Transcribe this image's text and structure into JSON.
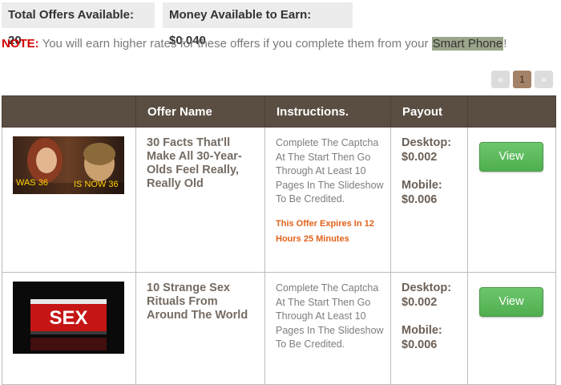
{
  "header": {
    "total_offers": "Total Offers Available: 20",
    "money_available": "Money Available to Earn: $0.040"
  },
  "note": {
    "label": "NOTE:",
    "text": " You will earn higher rates for these offers if you complete them from your ",
    "highlight": "Smart Phone",
    "end": "!"
  },
  "pagination": {
    "prev": "«",
    "current": "1",
    "next": "»"
  },
  "table": {
    "columns": [
      "",
      "Offer Name",
      "Instructions.",
      "Payout",
      ""
    ],
    "rows": [
      {
        "offer_name": "30 Facts That'll Make All 30-Year-Olds Feel Really, Really Old",
        "thumb_caption_left": "WAS 36",
        "thumb_caption_right": "IS NOW 36",
        "instructions": "Complete The Captcha At The Start Then Go Through At Least 10 Pages In The Slideshow To Be Credited.",
        "expires": "This Offer Expires In 12 Hours 25 Minutes",
        "desktop": "Desktop: $0.002",
        "mobile": "Mobile: $0.006",
        "button": "View"
      },
      {
        "offer_name": "10 Strange Sex Rituals From Around The World",
        "thumb_caption": "SEX",
        "instructions": "Complete The Captcha At The Start Then Go Through At Least 10 Pages In The Slideshow To Be Credited.",
        "desktop": "Desktop: $0.002",
        "mobile": "Mobile: $0.006",
        "button": "View"
      }
    ]
  },
  "colors": {
    "header_bg": "#5a4e42",
    "note_red": "#d40000",
    "expires_orange": "#e2621b",
    "button_green": "#5cb85c",
    "page_active": "#a48267"
  }
}
